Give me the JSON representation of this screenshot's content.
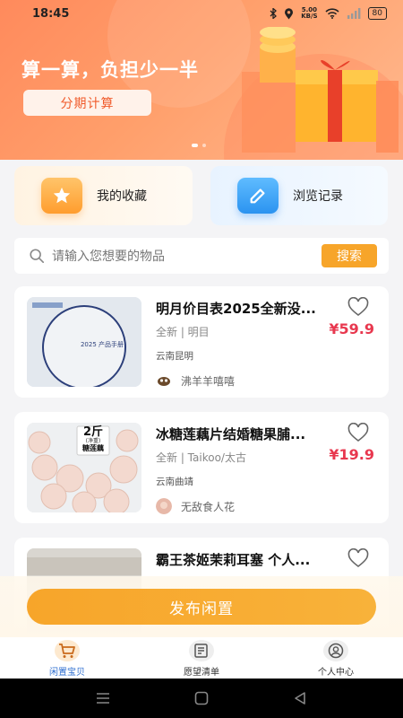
{
  "status_bar": {
    "time": "18:45",
    "net_speed_top": "5.00",
    "net_speed_unit": "KB/S",
    "battery": "80"
  },
  "banner": {
    "title": "算一算，负担少一半",
    "button_label": "分期计算",
    "page_indicator": {
      "count": 2,
      "active": 0
    }
  },
  "quick_links": [
    {
      "label": "我的收藏",
      "icon": "star-icon",
      "accent": "#ff9d2e"
    },
    {
      "label": "浏览记录",
      "icon": "pencil-icon",
      "accent": "#2b93f0"
    }
  ],
  "search": {
    "placeholder": "请输入您想要的物品",
    "button_label": "搜索"
  },
  "products": [
    {
      "title": "明月价目表2025全新没...",
      "condition": "全新 | 明目",
      "price": "¥59.9",
      "location": "云南昆明",
      "seller": "沸羊羊嘻嘻",
      "thumb_text": "2025 产品手册"
    },
    {
      "title": "冰糖莲藕片结婚糖果脯...",
      "condition": "全新 | Taikoo/太古",
      "price": "¥19.9",
      "location": "云南曲靖",
      "seller": "无敌食人花",
      "thumb_text_1": "2斤",
      "thumb_text_2": "(净重)",
      "thumb_text_3": "糖莲藕"
    },
    {
      "title": "霸王茶姬茉莉耳塞 个人..."
    }
  ],
  "publish": {
    "label": "发布闲置"
  },
  "tabs": [
    {
      "label": "闲置宝贝",
      "active": true,
      "icon": "cart-icon"
    },
    {
      "label": "愿望清单",
      "active": false,
      "icon": "list-icon"
    },
    {
      "label": "个人中心",
      "active": false,
      "icon": "user-icon"
    }
  ],
  "colors": {
    "accent_orange": "#f7a52a",
    "price_red": "#e8384f",
    "active_tab_blue": "#2f6fd0"
  }
}
